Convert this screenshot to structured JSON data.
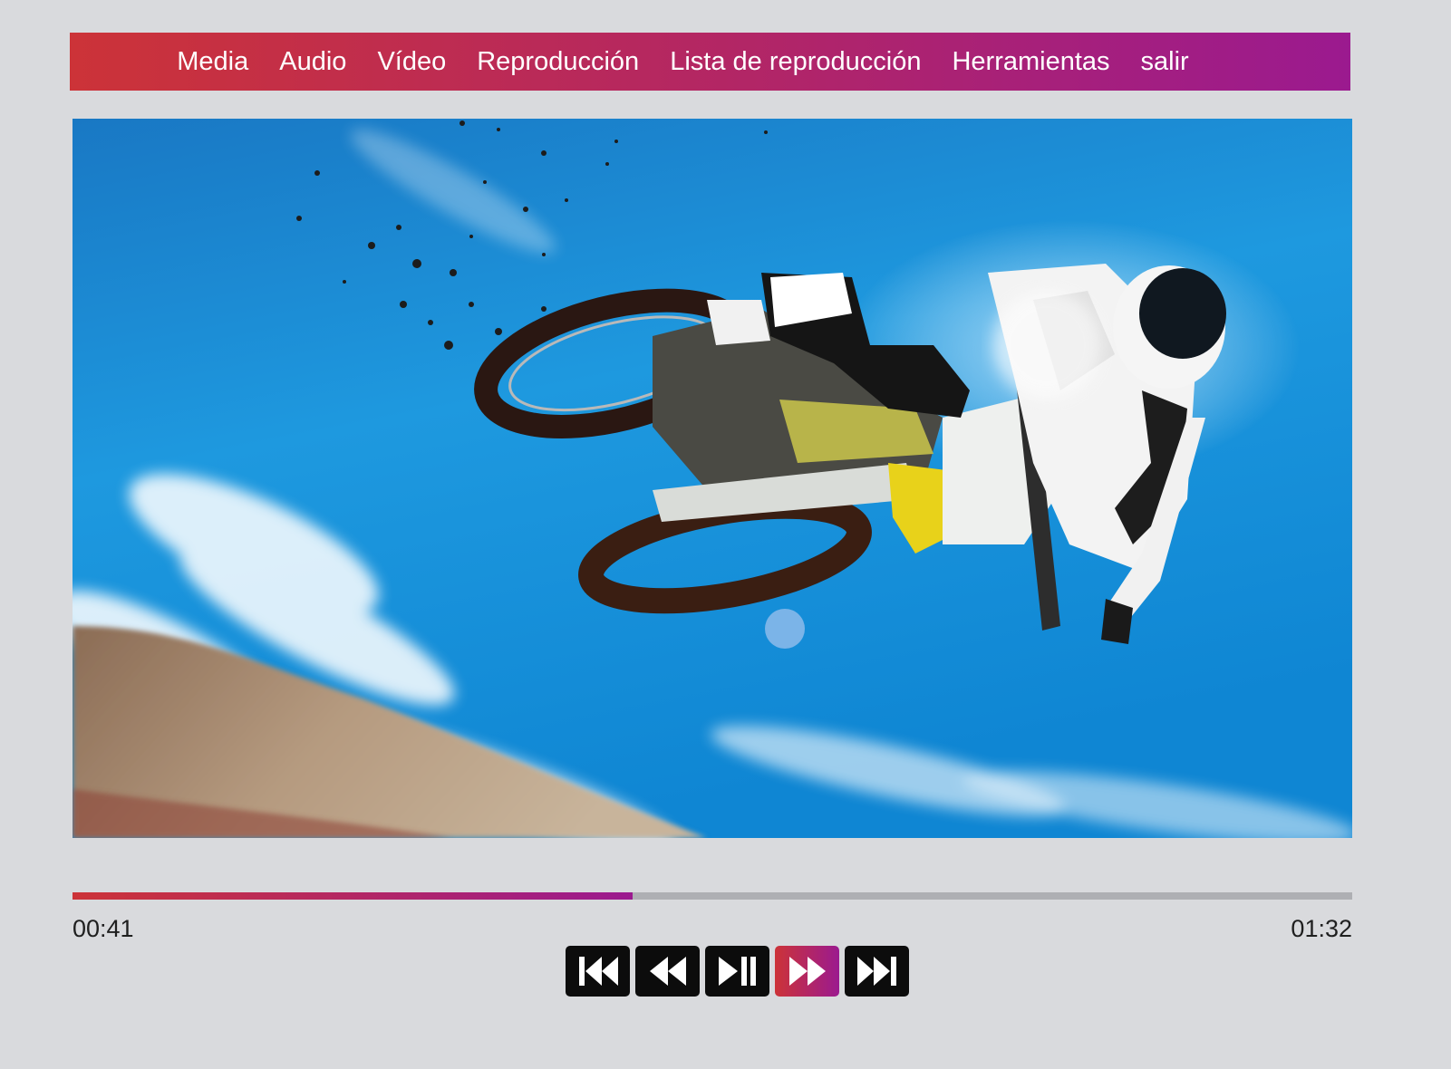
{
  "menu": {
    "items": [
      {
        "id": "media",
        "label": "Media"
      },
      {
        "id": "audio",
        "label": "Audio"
      },
      {
        "id": "video",
        "label": "Vídeo"
      },
      {
        "id": "playback",
        "label": "Reproducción"
      },
      {
        "id": "playlist",
        "label": "Lista de reproducción"
      },
      {
        "id": "tools",
        "label": "Herramientas"
      },
      {
        "id": "exit",
        "label": "salir"
      }
    ]
  },
  "player": {
    "current_time": "00:41",
    "total_time": "01:32",
    "progress": 0.4375
  },
  "controls": {
    "items": [
      {
        "id": "skip-back",
        "icon": "skip-back-icon",
        "active": false
      },
      {
        "id": "rewind",
        "icon": "rewind-icon",
        "active": false
      },
      {
        "id": "play-pause",
        "icon": "play-pause-icon",
        "active": false
      },
      {
        "id": "fast-forward",
        "icon": "fast-forward-icon",
        "active": true
      },
      {
        "id": "skip-forward",
        "icon": "skip-forward-icon",
        "active": false
      }
    ]
  },
  "theme": {
    "gradient_start": "#cc3338",
    "gradient_end": "#9b1a8f",
    "background": "#d9dadd",
    "button": "#0c0c0c"
  }
}
